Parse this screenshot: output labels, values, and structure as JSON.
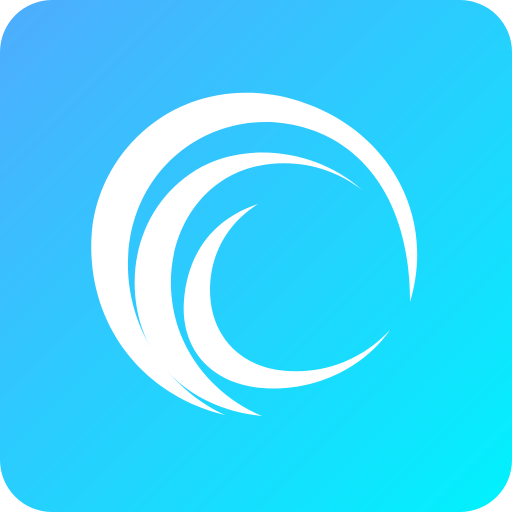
{
  "icon": {
    "name": "wave-spiral-icon",
    "gradient_start": "#4facfe",
    "gradient_end": "#00f2fe",
    "mark_color": "#ffffff"
  }
}
